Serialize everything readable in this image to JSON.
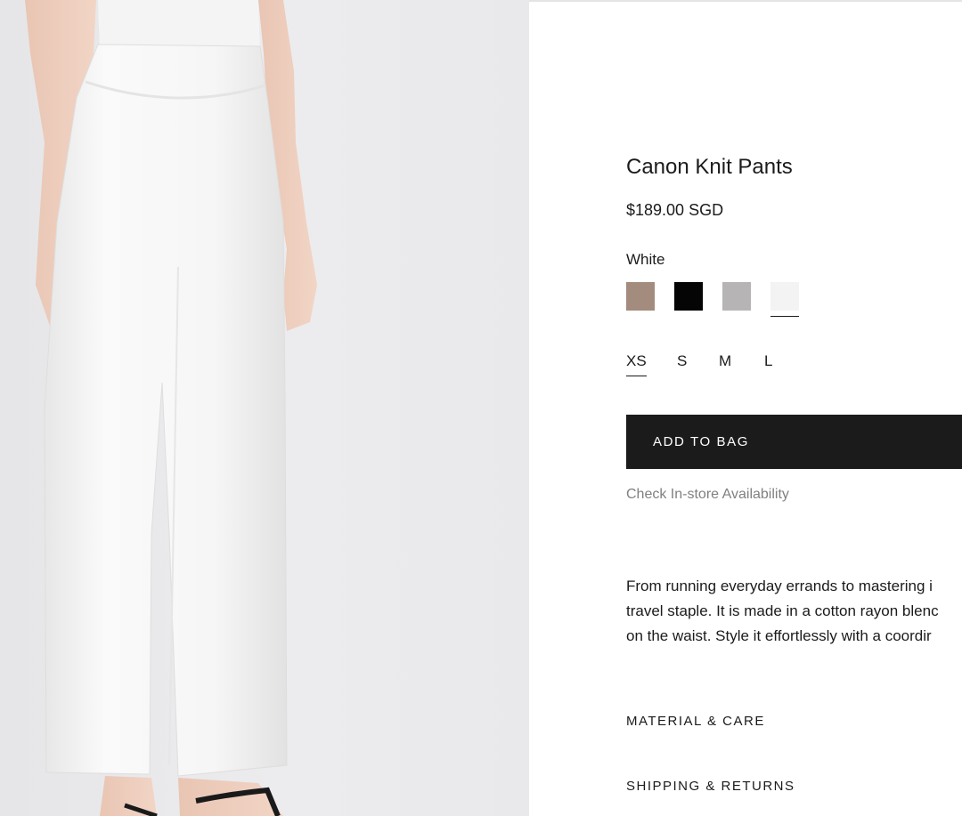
{
  "product": {
    "title": "Canon Knit Pants",
    "price": "$189.00 SGD",
    "color_label": "White",
    "description_lines": [
      "From running everyday errands to mastering i",
      "travel staple. It is made in a cotton rayon blenc",
      "on the waist. Style it effortlessly with a coordir"
    ]
  },
  "swatches": [
    {
      "color": "#a38b7d",
      "selected": false
    },
    {
      "color": "#050505",
      "selected": false
    },
    {
      "color": "#b7b4b5",
      "selected": false
    },
    {
      "color": "#f3f3f3",
      "selected": true
    }
  ],
  "sizes": [
    {
      "label": "XS",
      "selected": true
    },
    {
      "label": "S",
      "selected": false
    },
    {
      "label": "M",
      "selected": false
    },
    {
      "label": "L",
      "selected": false
    }
  ],
  "actions": {
    "add_to_bag": "ADD TO BAG",
    "availability": "Check In-store Availability"
  },
  "accordions": {
    "material_care": "MATERIAL & CARE",
    "shipping_returns": "SHIPPING & RETURNS"
  },
  "colors": {
    "button_bg": "#1b1b1b",
    "muted_text": "#808080",
    "photo_bg": "#e8e8ea"
  }
}
